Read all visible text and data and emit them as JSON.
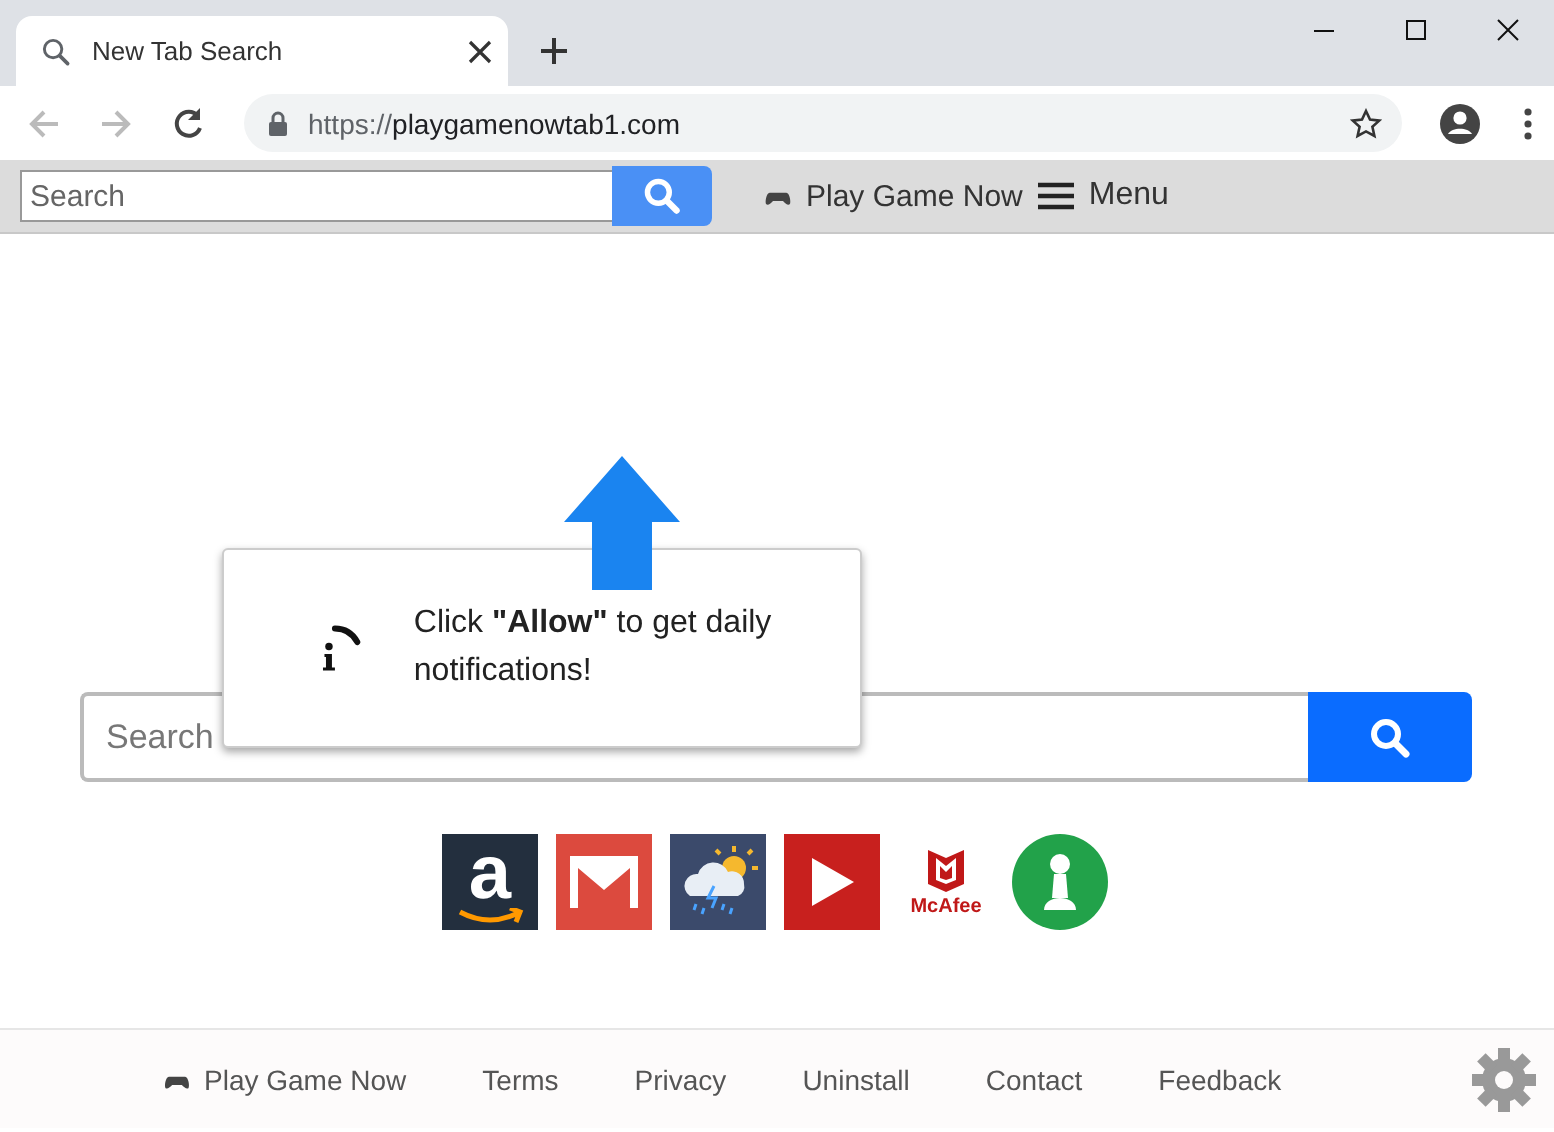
{
  "browser": {
    "tab_title": "New Tab Search",
    "url_scheme": "https://",
    "url_host": "playgamenowtab1.com"
  },
  "toolbar": {
    "search": {
      "placeholder": "Search"
    },
    "play_link": "Play Game Now",
    "menu": "Menu"
  },
  "notification": {
    "text": "Click **\"Allow\"** to get daily notifications!"
  },
  "main_search": {
    "placeholder": "Search"
  },
  "shortcuts": [
    {
      "kind": "amazon",
      "label": "a"
    },
    {
      "kind": "mail"
    },
    {
      "kind": "weather"
    },
    {
      "kind": "video"
    },
    {
      "kind": "mcafee",
      "label": "McAfee"
    },
    {
      "kind": "chess"
    }
  ],
  "footer": {
    "links": [
      "Play Game Now",
      "Terms",
      "Privacy",
      "Uninstall",
      "Contact",
      "Feedback"
    ]
  }
}
